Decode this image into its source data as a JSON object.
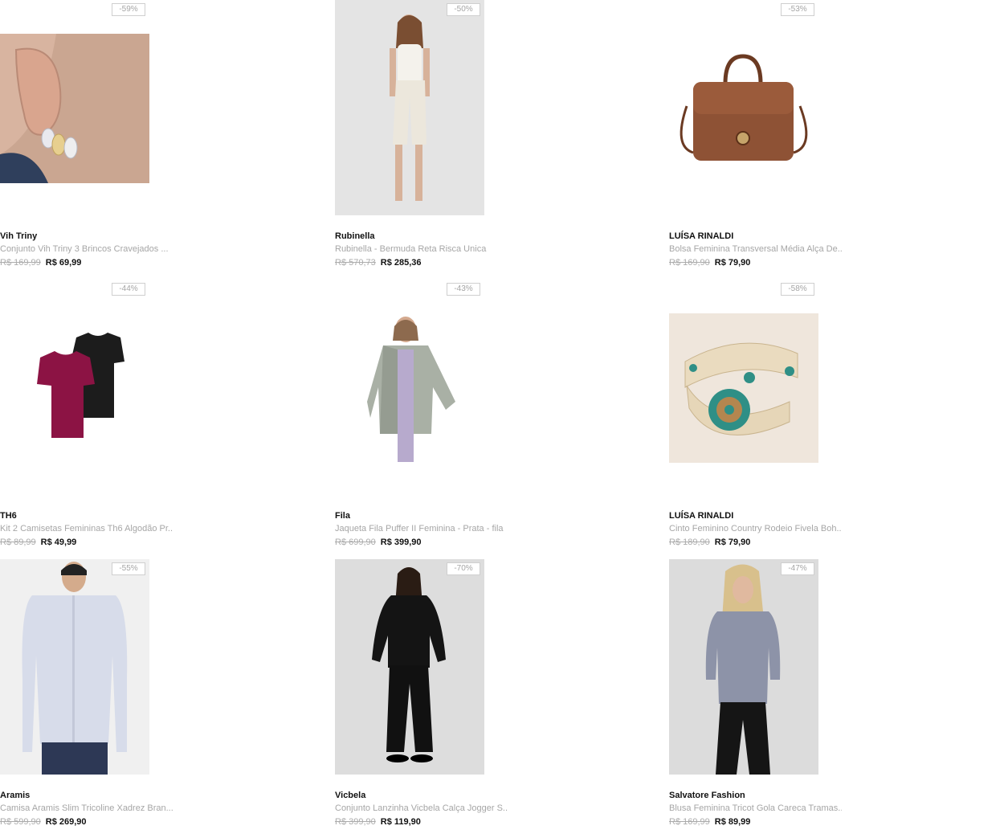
{
  "products": [
    {
      "brand": "Vih Triny",
      "title": "Conjunto Vih Triny 3 Brincos Cravejados ...",
      "old_price": "R$ 169,99",
      "price": "R$ 69,99",
      "discount": "-59%",
      "image": "earrings-photo"
    },
    {
      "brand": "Rubinella",
      "title": "Rubinella - Bermuda Reta Risca Unica",
      "old_price": "R$ 570,73",
      "price": "R$ 285,36",
      "discount": "-50%",
      "image": "white-outfit-model-photo"
    },
    {
      "brand": "LUÍSA RINALDI",
      "title": "Bolsa Feminina Transversal Média Alça De...",
      "old_price": "R$ 169,90",
      "price": "R$ 79,90",
      "discount": "-53%",
      "image": "brown-handbag-photo"
    },
    {
      "brand": "TH6",
      "title": "Kit 2 Camisetas Femininas Th6 Algodão Pr...",
      "old_price": "R$ 89,99",
      "price": "R$ 49,99",
      "discount": "-44%",
      "image": "two-tshirts-photo"
    },
    {
      "brand": "Fila",
      "title": "Jaqueta Fila Puffer II Feminina - Prata - fila",
      "old_price": "R$ 699,90",
      "price": "R$ 399,90",
      "discount": "-43%",
      "image": "silver-puffer-jacket-photo"
    },
    {
      "brand": "LUÍSA RINALDI",
      "title": "Cinto Feminino Country Rodeio Fivela Boh...",
      "old_price": "R$ 189,90",
      "price": "R$ 79,90",
      "discount": "-58%",
      "image": "boho-belt-photo"
    },
    {
      "brand": "Aramis",
      "title": "Camisa Aramis Slim Tricoline Xadrez Bran...",
      "old_price": "R$ 599,90",
      "price": "R$ 269,90",
      "discount": "-55%",
      "image": "mens-shirt-photo"
    },
    {
      "brand": "Vicbela",
      "title": "Conjunto Lanzinha Vicbela Calça Jogger S...",
      "old_price": "R$ 399,90",
      "price": "R$ 119,90",
      "discount": "-70%",
      "image": "black-jogger-set-photo"
    },
    {
      "brand": "Salvatore Fashion",
      "title": "Blusa Feminina Tricot Gola Careca Tramas...",
      "old_price": "R$ 169,99",
      "price": "R$ 89,99",
      "discount": "-47%",
      "image": "grey-knit-sweater-photo"
    }
  ],
  "colors": {
    "badge_border": "#cfcfcf",
    "muted_text": "#a6a6a6",
    "price_text": "#111111"
  }
}
